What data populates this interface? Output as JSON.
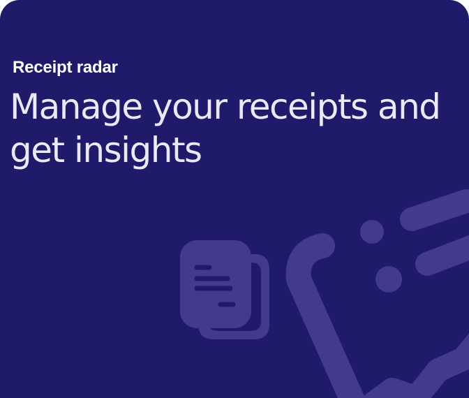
{
  "card": {
    "eyebrow": "Receipt radar",
    "headline": "Manage your receipts and get insights"
  },
  "colors": {
    "background": "#201a6b",
    "headline_text": "#ebe9f7",
    "eyebrow_text": "#ffffff",
    "illustration": "#433a8e"
  },
  "icons": [
    "receipt-documents-icon",
    "insights-chart-icon"
  ]
}
